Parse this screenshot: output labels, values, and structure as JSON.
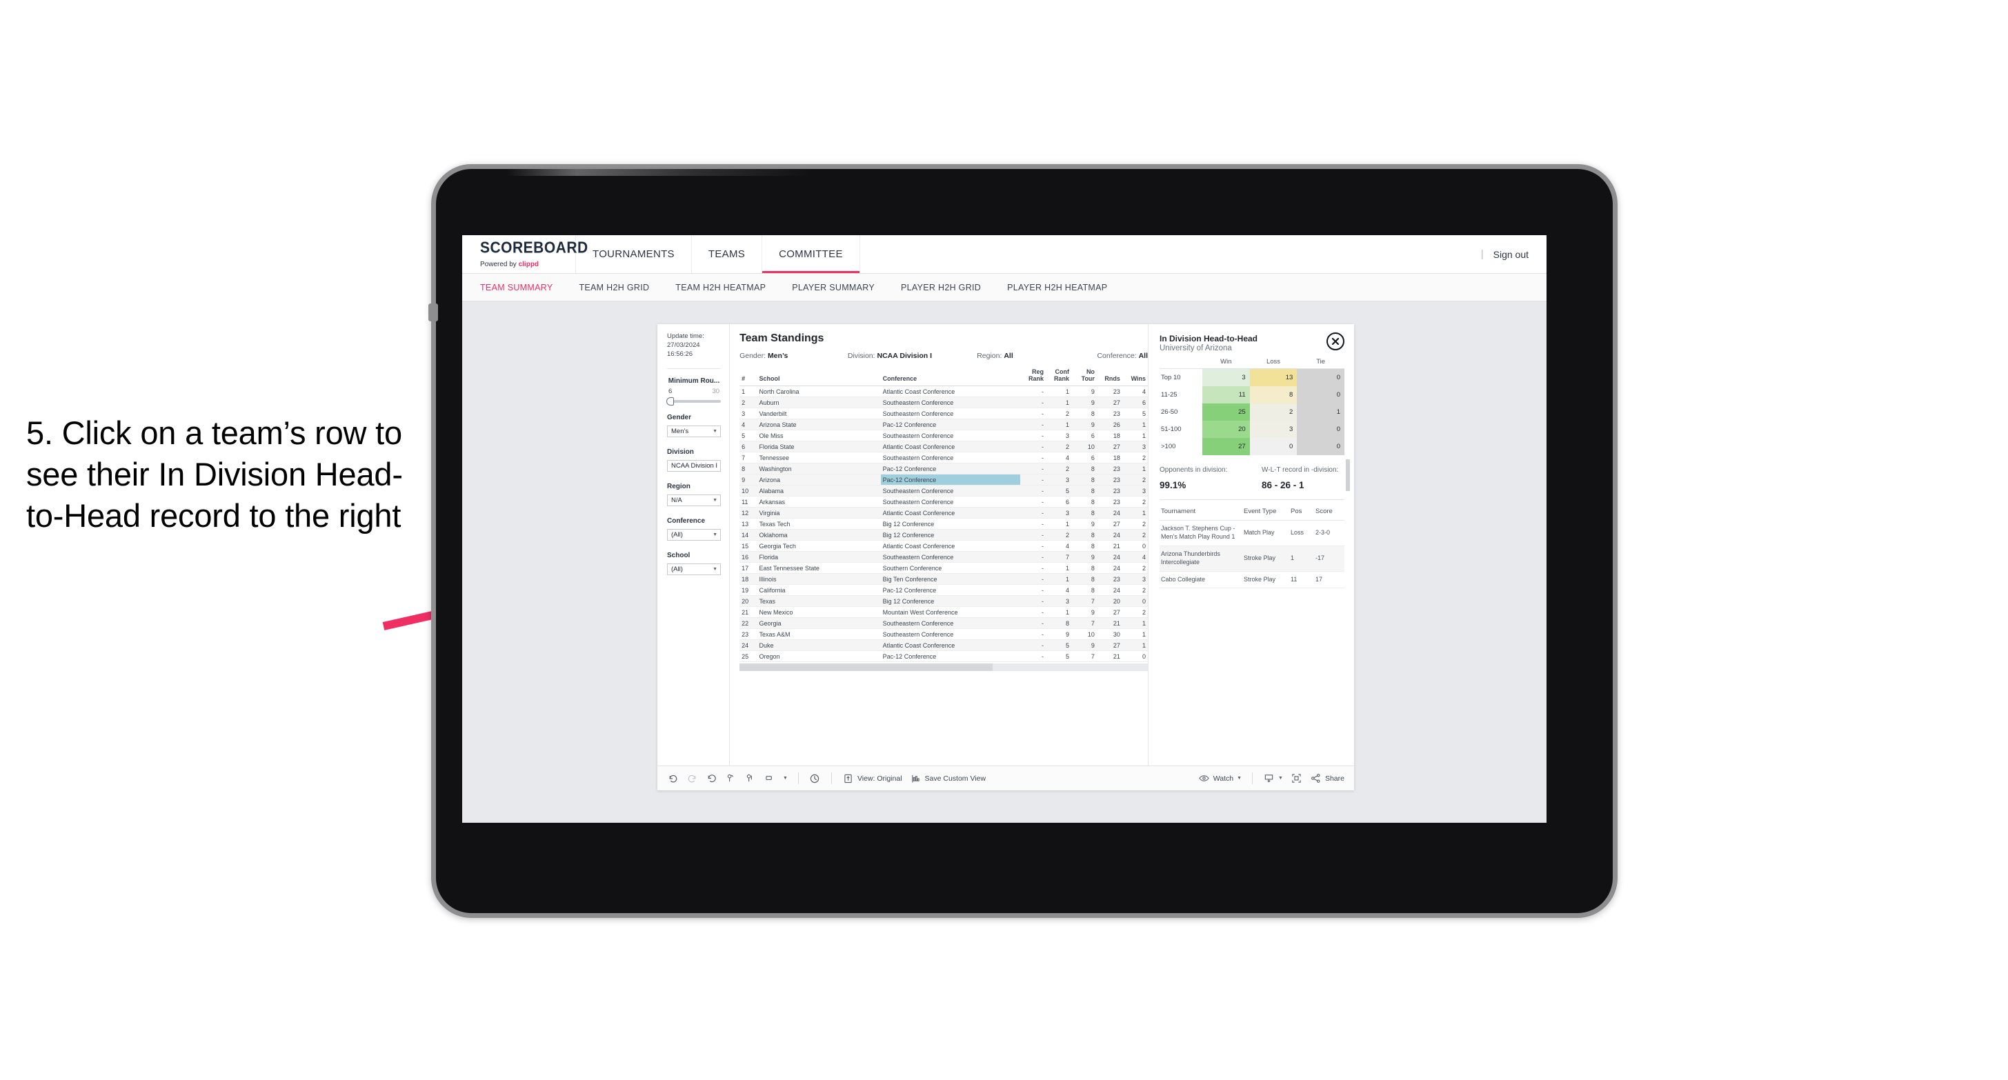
{
  "annotation": {
    "text": "5. Click on a team’s row to see their In Division Head-to-Head record to the right",
    "arrow_color": "#ef2e63"
  },
  "app": {
    "brand_title": "SCOREBOARD",
    "brand_powered": "Powered by",
    "brand_name": "clippd",
    "nav": [
      {
        "label": "TOURNAMENTS",
        "active": false
      },
      {
        "label": "TEAMS",
        "active": false
      },
      {
        "label": "COMMITTEE",
        "active": true
      }
    ],
    "divider": "|",
    "sign_out": "Sign out",
    "subtabs": [
      {
        "label": "TEAM SUMMARY",
        "active": true
      },
      {
        "label": "TEAM H2H GRID",
        "active": false
      },
      {
        "label": "TEAM H2H HEATMAP",
        "active": false
      },
      {
        "label": "PLAYER SUMMARY",
        "active": false
      },
      {
        "label": "PLAYER H2H GRID",
        "active": false
      },
      {
        "label": "PLAYER H2H HEATMAP",
        "active": false
      }
    ]
  },
  "filters": {
    "update_label": "Update time:",
    "update_value": "27/03/2024 16:56:26",
    "slider": {
      "title": "Minimum Rou...",
      "min": "6",
      "max": "30"
    },
    "selects": [
      {
        "label": "Gender",
        "value": "Men’s"
      },
      {
        "label": "Division",
        "value": "NCAA Division I"
      },
      {
        "label": "Region",
        "value": "N/A"
      },
      {
        "label": "Conference",
        "value": "(All)"
      },
      {
        "label": "School",
        "value": "(All)"
      }
    ]
  },
  "standings": {
    "title": "Team Standings",
    "meta": [
      {
        "label": "Gender:",
        "value": "Men’s"
      },
      {
        "label": "Division:",
        "value": "NCAA Division I"
      },
      {
        "label": "Region:",
        "value": "All"
      },
      {
        "label": "Conference:",
        "value": "All"
      }
    ],
    "columns": [
      "#",
      "School",
      "Conference",
      "Reg Rank",
      "Conf Rank",
      "No Tour",
      "Rnds",
      "Wins"
    ],
    "highlight_color": "#9fcedd",
    "rows": [
      {
        "n": "1",
        "school": "North Carolina",
        "conf": "Atlantic Coast Conference",
        "reg": "-",
        "cr": "1",
        "nt": "9",
        "rnds": "23",
        "wins": "4"
      },
      {
        "n": "2",
        "school": "Auburn",
        "conf": "Southeastern Conference",
        "reg": "-",
        "cr": "1",
        "nt": "9",
        "rnds": "27",
        "wins": "6"
      },
      {
        "n": "3",
        "school": "Vanderbilt",
        "conf": "Southeastern Conference",
        "reg": "-",
        "cr": "2",
        "nt": "8",
        "rnds": "23",
        "wins": "5"
      },
      {
        "n": "4",
        "school": "Arizona State",
        "conf": "Pac-12 Conference",
        "reg": "-",
        "cr": "1",
        "nt": "9",
        "rnds": "26",
        "wins": "1"
      },
      {
        "n": "5",
        "school": "Ole Miss",
        "conf": "Southeastern Conference",
        "reg": "-",
        "cr": "3",
        "nt": "6",
        "rnds": "18",
        "wins": "1"
      },
      {
        "n": "6",
        "school": "Florida State",
        "conf": "Atlantic Coast Conference",
        "reg": "-",
        "cr": "2",
        "nt": "10",
        "rnds": "27",
        "wins": "3"
      },
      {
        "n": "7",
        "school": "Tennessee",
        "conf": "Southeastern Conference",
        "reg": "-",
        "cr": "4",
        "nt": "6",
        "rnds": "18",
        "wins": "2"
      },
      {
        "n": "8",
        "school": "Washington",
        "conf": "Pac-12 Conference",
        "reg": "-",
        "cr": "2",
        "nt": "8",
        "rnds": "23",
        "wins": "1"
      },
      {
        "n": "9",
        "school": "Arizona",
        "conf": "Pac-12 Conference",
        "reg": "-",
        "cr": "3",
        "nt": "8",
        "rnds": "23",
        "wins": "2",
        "selected": true
      },
      {
        "n": "10",
        "school": "Alabama",
        "conf": "Southeastern Conference",
        "reg": "-",
        "cr": "5",
        "nt": "8",
        "rnds": "23",
        "wins": "3"
      },
      {
        "n": "11",
        "school": "Arkansas",
        "conf": "Southeastern Conference",
        "reg": "-",
        "cr": "6",
        "nt": "8",
        "rnds": "23",
        "wins": "2"
      },
      {
        "n": "12",
        "school": "Virginia",
        "conf": "Atlantic Coast Conference",
        "reg": "-",
        "cr": "3",
        "nt": "8",
        "rnds": "24",
        "wins": "1"
      },
      {
        "n": "13",
        "school": "Texas Tech",
        "conf": "Big 12 Conference",
        "reg": "-",
        "cr": "1",
        "nt": "9",
        "rnds": "27",
        "wins": "2"
      },
      {
        "n": "14",
        "school": "Oklahoma",
        "conf": "Big 12 Conference",
        "reg": "-",
        "cr": "2",
        "nt": "8",
        "rnds": "24",
        "wins": "2"
      },
      {
        "n": "15",
        "school": "Georgia Tech",
        "conf": "Atlantic Coast Conference",
        "reg": "-",
        "cr": "4",
        "nt": "8",
        "rnds": "21",
        "wins": "0"
      },
      {
        "n": "16",
        "school": "Florida",
        "conf": "Southeastern Conference",
        "reg": "-",
        "cr": "7",
        "nt": "9",
        "rnds": "24",
        "wins": "4"
      },
      {
        "n": "17",
        "school": "East Tennessee State",
        "conf": "Southern Conference",
        "reg": "-",
        "cr": "1",
        "nt": "8",
        "rnds": "24",
        "wins": "2"
      },
      {
        "n": "18",
        "school": "Illinois",
        "conf": "Big Ten Conference",
        "reg": "-",
        "cr": "1",
        "nt": "8",
        "rnds": "23",
        "wins": "3"
      },
      {
        "n": "19",
        "school": "California",
        "conf": "Pac-12 Conference",
        "reg": "-",
        "cr": "4",
        "nt": "8",
        "rnds": "24",
        "wins": "2"
      },
      {
        "n": "20",
        "school": "Texas",
        "conf": "Big 12 Conference",
        "reg": "-",
        "cr": "3",
        "nt": "7",
        "rnds": "20",
        "wins": "0"
      },
      {
        "n": "21",
        "school": "New Mexico",
        "conf": "Mountain West Conference",
        "reg": "-",
        "cr": "1",
        "nt": "9",
        "rnds": "27",
        "wins": "2"
      },
      {
        "n": "22",
        "school": "Georgia",
        "conf": "Southeastern Conference",
        "reg": "-",
        "cr": "8",
        "nt": "7",
        "rnds": "21",
        "wins": "1"
      },
      {
        "n": "23",
        "school": "Texas A&M",
        "conf": "Southeastern Conference",
        "reg": "-",
        "cr": "9",
        "nt": "10",
        "rnds": "30",
        "wins": "1"
      },
      {
        "n": "24",
        "school": "Duke",
        "conf": "Atlantic Coast Conference",
        "reg": "-",
        "cr": "5",
        "nt": "9",
        "rnds": "27",
        "wins": "1"
      },
      {
        "n": "25",
        "school": "Oregon",
        "conf": "Pac-12 Conference",
        "reg": "-",
        "cr": "5",
        "nt": "7",
        "rnds": "21",
        "wins": "0"
      }
    ]
  },
  "h2h": {
    "title": "In Division Head-to-Head",
    "subtitle": "University of Arizona",
    "close_icon": "close-icon",
    "columns": [
      "",
      "Win",
      "Loss",
      "Tie"
    ],
    "rows": [
      {
        "bucket": "Top 10",
        "win": "3",
        "loss": "13",
        "tie": "0",
        "win_color": "#dfeedd",
        "loss_color": "#f2e199",
        "tie_color": "#d3d3d3"
      },
      {
        "bucket": "11-25",
        "win": "11",
        "loss": "8",
        "tie": "0",
        "win_color": "#c7e5bd",
        "loss_color": "#f5eccb",
        "tie_color": "#d3d3d3"
      },
      {
        "bucket": "26-50",
        "win": "25",
        "loss": "2",
        "tie": "1",
        "win_color": "#87d07a",
        "loss_color": "#efeee5",
        "tie_color": "#d3d3d3"
      },
      {
        "bucket": "51-100",
        "win": "20",
        "loss": "3",
        "tie": "0",
        "win_color": "#9bda8c",
        "loss_color": "#f0efe5",
        "tie_color": "#d3d3d3"
      },
      {
        "bucket": ">100",
        "win": "27",
        "loss": "0",
        "tie": "0",
        "win_color": "#87d07a",
        "loss_color": "#f0f0f0",
        "tie_color": "#d3d3d3"
      }
    ],
    "stats": [
      {
        "label": "Opponents in division:",
        "value": "99.1%"
      },
      {
        "label": "W-L-T record in -division:",
        "value": "86 - 26 - 1"
      }
    ],
    "tournaments": {
      "columns": [
        "Tournament",
        "Event Type",
        "Pos",
        "Score"
      ],
      "rows": [
        {
          "name": "Jackson T. Stephens Cup - Men’s Match Play Round 1",
          "type": "Match Play",
          "pos": "Loss",
          "score": "2-3-0"
        },
        {
          "name": "Arizona Thunderbirds Intercollegiate",
          "type": "Stroke Play",
          "pos": "1",
          "score": "-17"
        },
        {
          "name": "Cabo Collegiate",
          "type": "Stroke Play",
          "pos": "11",
          "score": "17"
        }
      ]
    }
  },
  "toolbar": {
    "icons": [
      "undo-icon",
      "redo-icon",
      "revert-icon",
      "refresh-data-icon",
      "pause-updates-icon",
      "highlight-icon"
    ],
    "clock_icon": "clock-icon",
    "view_label": "View: Original",
    "view_icon": "view-icon",
    "save_label": "Save Custom View",
    "save_icon": "save-view-icon",
    "watch_label": "Watch",
    "watch_icon": "eye-icon",
    "download_icon": "download-icon",
    "fullscreen_icon": "fullscreen-icon",
    "share_label": "Share",
    "share_icon": "share-icon"
  }
}
